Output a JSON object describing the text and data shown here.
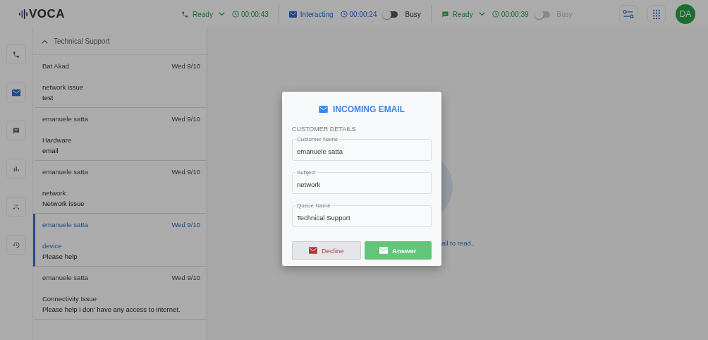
{
  "header": {
    "logo": "VOCA",
    "avatar": "DA"
  },
  "channels": [
    {
      "kind": "voice",
      "status": "Ready",
      "timer": "00:00:43"
    },
    {
      "kind": "email",
      "status": "Interacting",
      "timer": "00:00:24",
      "busy_label": "Busy",
      "busy_on": false,
      "disabled": false
    },
    {
      "kind": "chat",
      "status": "Ready",
      "timer": "00:00:39",
      "busy_label": "Busy",
      "busy_on": false,
      "disabled": true
    }
  ],
  "rail": [
    {
      "kind": "phone",
      "selected": false
    },
    {
      "kind": "email",
      "selected": true
    },
    {
      "kind": "chat",
      "selected": false
    },
    {
      "kind": "stats",
      "selected": false
    },
    {
      "kind": "missed",
      "selected": false
    },
    {
      "kind": "history",
      "selected": false
    }
  ],
  "queue": {
    "title": "Technical Support",
    "expanded": true,
    "items": [
      {
        "name": "Bat Akad",
        "date": "Wed 9/10",
        "subject": "network issue",
        "body": "test",
        "selected": false
      },
      {
        "name": "emanuele satta",
        "date": "Wed 9/10",
        "subject": "Hardware",
        "body": "email",
        "selected": false
      },
      {
        "name": "emanuele satta",
        "date": "Wed 9/10",
        "subject": "network",
        "body": "Network issue",
        "selected": false
      },
      {
        "name": "emanuele satta",
        "date": "Wed 9/10",
        "subject": "device",
        "body": "Please help",
        "selected": true
      },
      {
        "name": "emanuele satta",
        "date": "Wed 9/10",
        "subject": "Connectivity Issue",
        "body": "Please help i don' have any access to internet.",
        "selected": false
      }
    ]
  },
  "empty_hint": "ail to read..",
  "modal": {
    "title": "INCOMING EMAIL",
    "section": "CUSTOMER DETAILS",
    "fields": [
      {
        "label": "Customer Name",
        "value": "emanuele satta"
      },
      {
        "label": "Subject",
        "value": "network"
      },
      {
        "label": "Queue Name",
        "value": "Technical Support"
      }
    ],
    "buttons": [
      {
        "kind": "decline",
        "label": "Decline"
      },
      {
        "kind": "answer",
        "label": "Answer"
      }
    ]
  }
}
